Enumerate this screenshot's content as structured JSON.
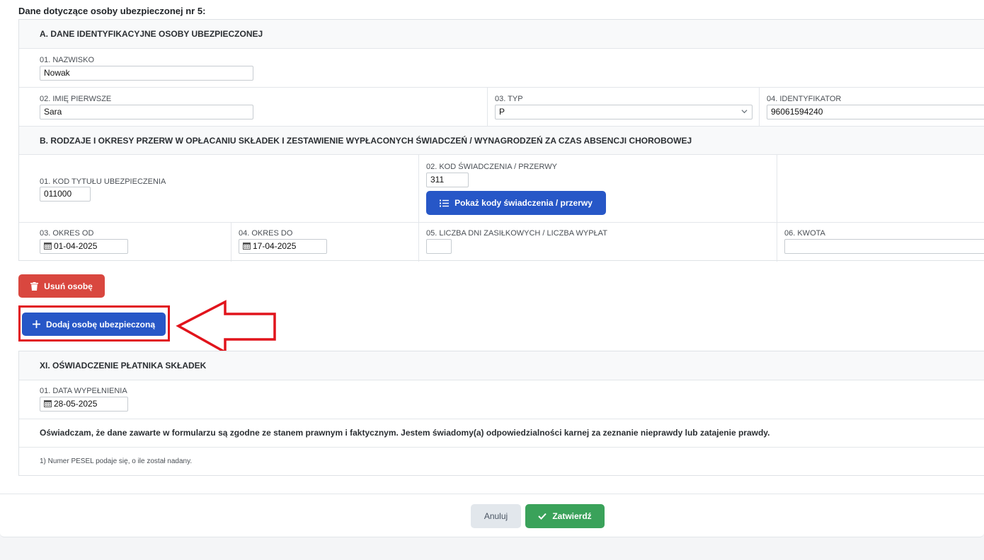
{
  "person_title": "Dane dotyczące osoby ubezpieczonej nr 5:",
  "section_a": {
    "title": "A. DANE IDENTYFIKACYJNE OSOBY UBEZPIECZONEJ",
    "nazwisko_label": "01. NAZWISKO",
    "nazwisko_value": "Nowak",
    "imie_label": "02. IMIĘ PIERWSZE",
    "imie_value": "Sara",
    "typ_label": "03. TYP",
    "typ_value": "P",
    "identyfikator_label": "04. IDENTYFIKATOR",
    "identyfikator_value": "96061594240"
  },
  "section_b": {
    "title": "B. RODZAJE I OKRESY PRZERW W OPŁACANIU SKŁADEK I ZESTAWIENIE WYPŁACONYCH ŚWIADCZEŃ / WYNAGRODZEŃ ZA CZAS ABSENCJI CHOROBOWEJ",
    "kod_tytulu_label": "01. KOD TYTUŁU UBEZPIECZENIA",
    "kod_tytulu_value": "011000",
    "kod_swiadczenia_label": "02. KOD ŚWIADCZENIA / PRZERWY",
    "kod_swiadczenia_value": "311",
    "show_codes_button": "Pokaż kody świadczenia / przerwy",
    "okres_od_label": "03. OKRES OD",
    "okres_od_value": "01-04-2025",
    "okres_do_label": "04. OKRES DO",
    "okres_do_value": "17-04-2025",
    "liczba_dni_label": "05. LICZBA DNI ZASIŁKOWYCH / LICZBA WYPŁAT",
    "liczba_dni_value": "",
    "kwota_label": "06. KWOTA",
    "kwota_value": ""
  },
  "buttons": {
    "remove_person": "Usuń osobę",
    "add_person": "Dodaj osobę ubezpieczoną",
    "cancel": "Anuluj",
    "confirm": "Zatwierdź"
  },
  "section_xi": {
    "title": "XI. OŚWIADCZENIE PŁATNIKA SKŁADEK",
    "data_label": "01. DATA WYPEŁNIENIA",
    "data_value": "28-05-2025",
    "declaration": "Oświadczam, że dane zawarte w formularzu są zgodne ze stanem prawnym i faktycznym. Jestem świadomy(a) odpowiedzialności karnej za zeznanie nieprawdy lub zatajenie prawdy.",
    "footnote": "1) Numer PESEL podaje się, o ile został nadany."
  },
  "colors": {
    "primary": "#2757c7",
    "danger": "#d9473f",
    "success": "#3aa25a",
    "annotation_red": "#e1141c"
  },
  "icons": {
    "calendar": "calendar-icon",
    "list": "list-icon",
    "trash": "trash-icon",
    "plus": "plus-icon",
    "check": "check-icon",
    "chevron": "chevron-down-icon",
    "arrow": "annotation-arrow"
  }
}
